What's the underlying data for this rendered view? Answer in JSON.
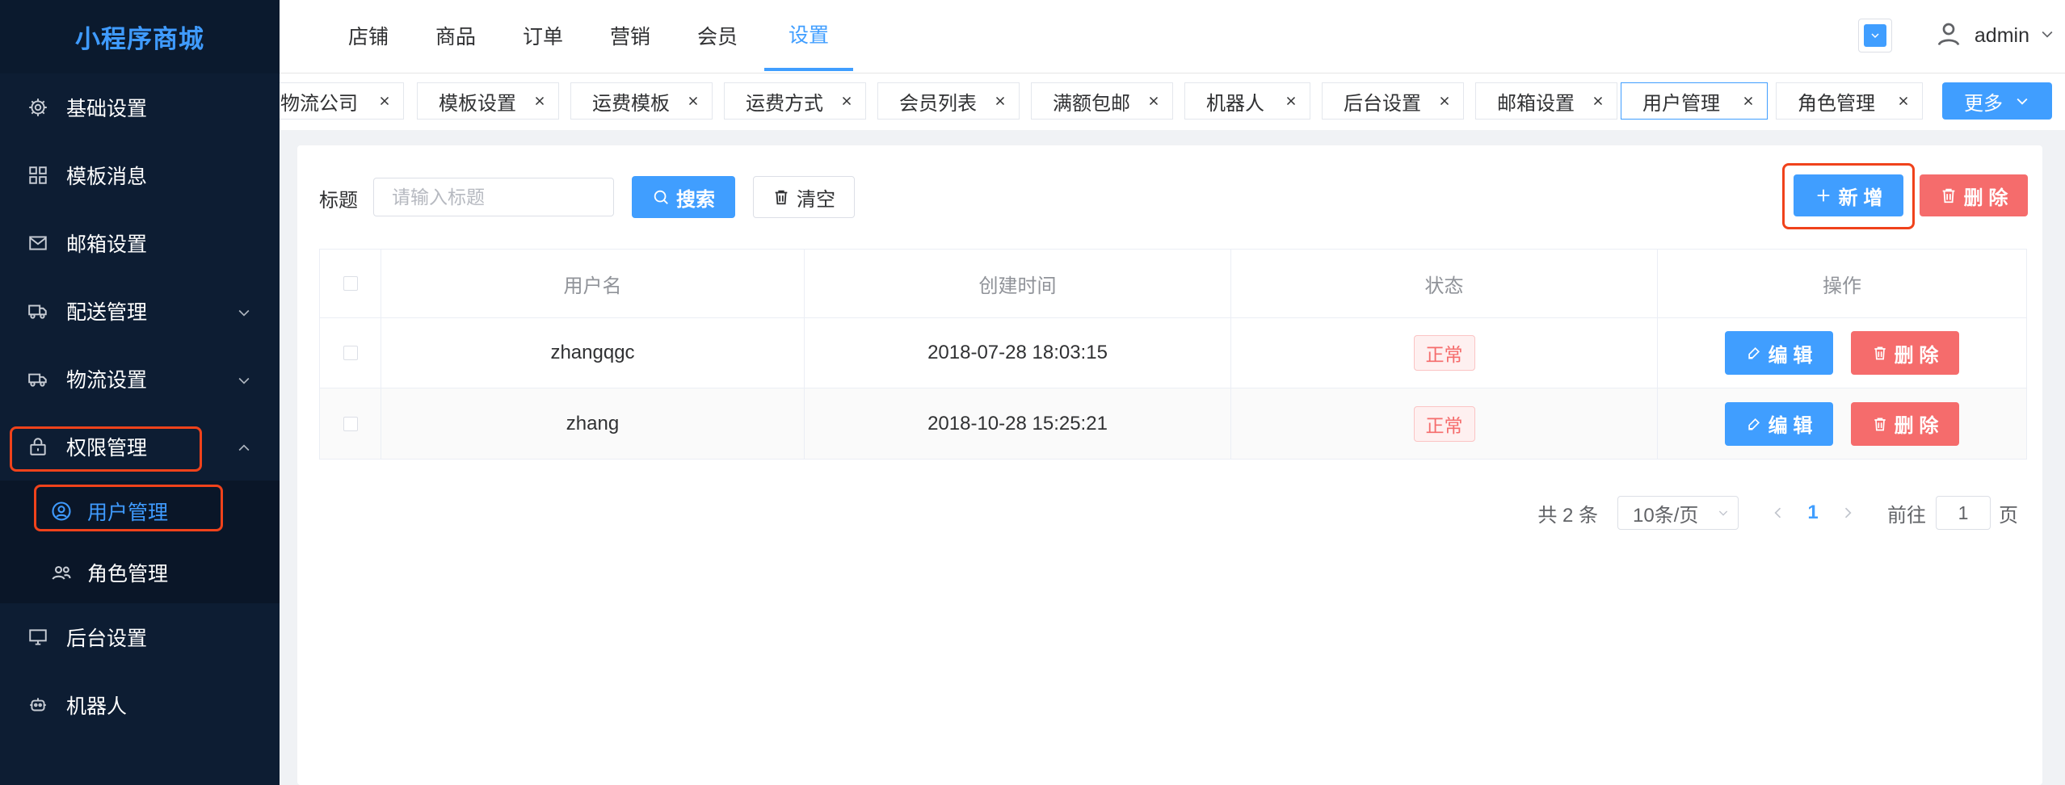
{
  "app": {
    "title": "小程序商城"
  },
  "sidebar": {
    "items": [
      {
        "label": "基础设置",
        "icon": "gear-icon"
      },
      {
        "label": "模板消息",
        "icon": "grid-icon"
      },
      {
        "label": "邮箱设置",
        "icon": "mail-icon"
      },
      {
        "label": "配送管理",
        "icon": "truck-icon",
        "expandable": true
      },
      {
        "label": "物流设置",
        "icon": "truck-icon",
        "expandable": true
      },
      {
        "label": "权限管理",
        "icon": "lock-icon",
        "expanded": true
      },
      {
        "label": "后台设置",
        "icon": "monitor-icon"
      },
      {
        "label": "机器人",
        "icon": "robot-icon"
      }
    ],
    "submenu": [
      {
        "label": "用户管理",
        "icon": "user-circle-icon",
        "active": true
      },
      {
        "label": "角色管理",
        "icon": "users-icon"
      }
    ]
  },
  "topnav": {
    "tabs": [
      "店铺",
      "商品",
      "订单",
      "营销",
      "会员",
      "设置"
    ],
    "active": "设置",
    "user": "admin"
  },
  "tabsbar": {
    "tags": [
      "物流公司",
      "模板设置",
      "运费模板",
      "运费方式",
      "会员列表",
      "满额包邮",
      "机器人",
      "后台设置",
      "邮箱设置",
      "用户管理",
      "角色管理"
    ],
    "active": "用户管理",
    "more_label": "更多"
  },
  "filter": {
    "label": "标题",
    "placeholder": "请输入标题",
    "search_label": "搜索",
    "clear_label": "清空"
  },
  "actions": {
    "add_label": "新 增",
    "delete_label": "删 除"
  },
  "table": {
    "columns": [
      "用户名",
      "创建时间",
      "状态",
      "操作"
    ],
    "rows": [
      {
        "username": "zhangqgc",
        "created": "2018-07-28 18:03:15",
        "status": "正常"
      },
      {
        "username": "zhang",
        "created": "2018-10-28 15:25:21",
        "status": "正常"
      }
    ],
    "edit_label": "编 辑",
    "delete_label": "删 除"
  },
  "pagination": {
    "total": "共 2 条",
    "page_size": "10条/页",
    "current_page": "1",
    "goto_prefix": "前往",
    "goto_value": "1",
    "goto_suffix": "页"
  },
  "colors": {
    "primary": "#409eff",
    "danger": "#f56c6c",
    "sidebar": "#0d1d33",
    "highlight": "#f0421b"
  }
}
